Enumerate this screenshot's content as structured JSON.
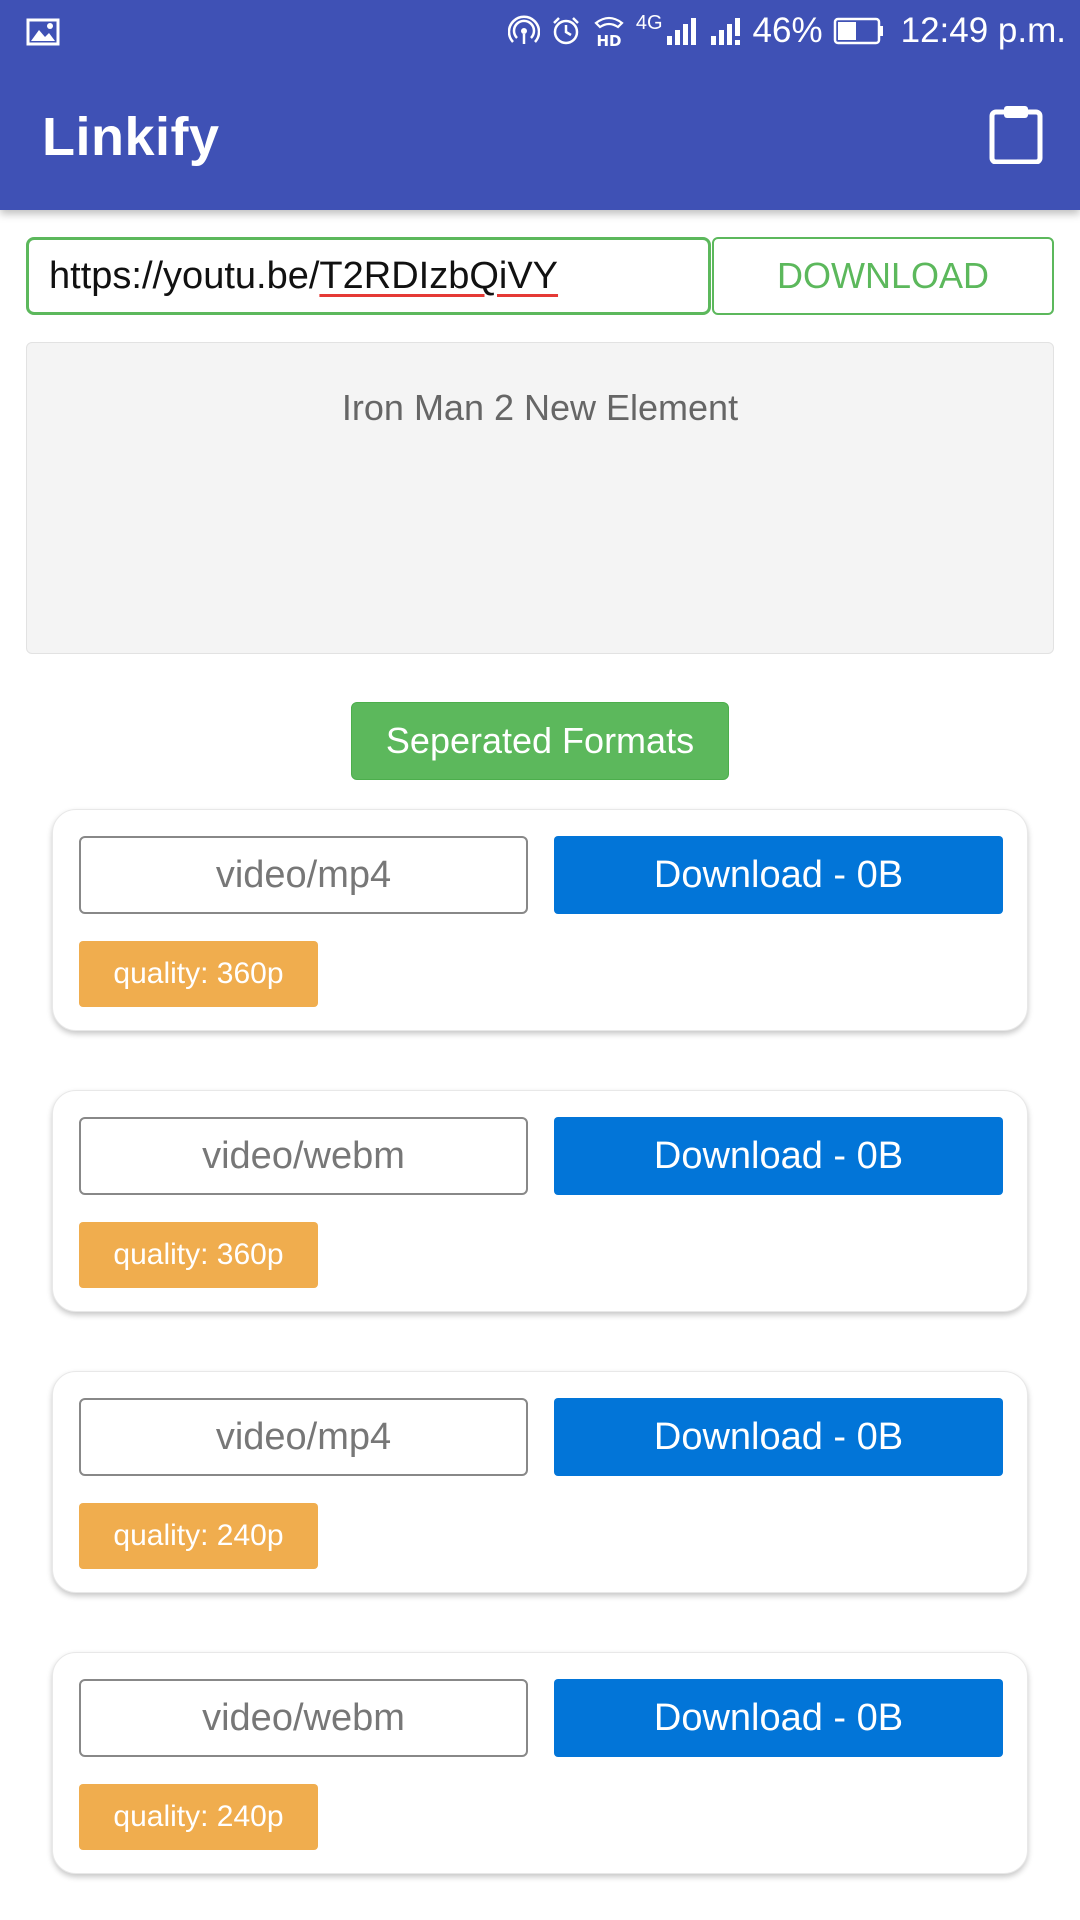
{
  "status_bar": {
    "battery_percent": "46%",
    "network_label": "4G",
    "hd_label": "HD",
    "time": "12:49 p.m."
  },
  "app_bar": {
    "title": "Linkify"
  },
  "url_input": {
    "value_prefix": "https://youtu.be/",
    "value_id": "T2RDIzbQiVY"
  },
  "download_button_label": "DOWNLOAD",
  "video": {
    "title": "Iron Man 2 New Element"
  },
  "formats_button_label": "Seperated Formats",
  "formats": [
    {
      "mime": "video/mp4",
      "download_label": "Download - 0B",
      "quality": "quality: 360p"
    },
    {
      "mime": "video/webm",
      "download_label": "Download - 0B",
      "quality": "quality: 360p"
    },
    {
      "mime": "video/mp4",
      "download_label": "Download - 0B",
      "quality": "quality: 240p"
    },
    {
      "mime": "video/webm",
      "download_label": "Download - 0B",
      "quality": "quality: 240p"
    }
  ],
  "colors": {
    "app_bar": "#3F51B5",
    "success_green": "#5CB85C",
    "primary_blue": "#0275D8",
    "warning_orange": "#F0AD4E"
  }
}
